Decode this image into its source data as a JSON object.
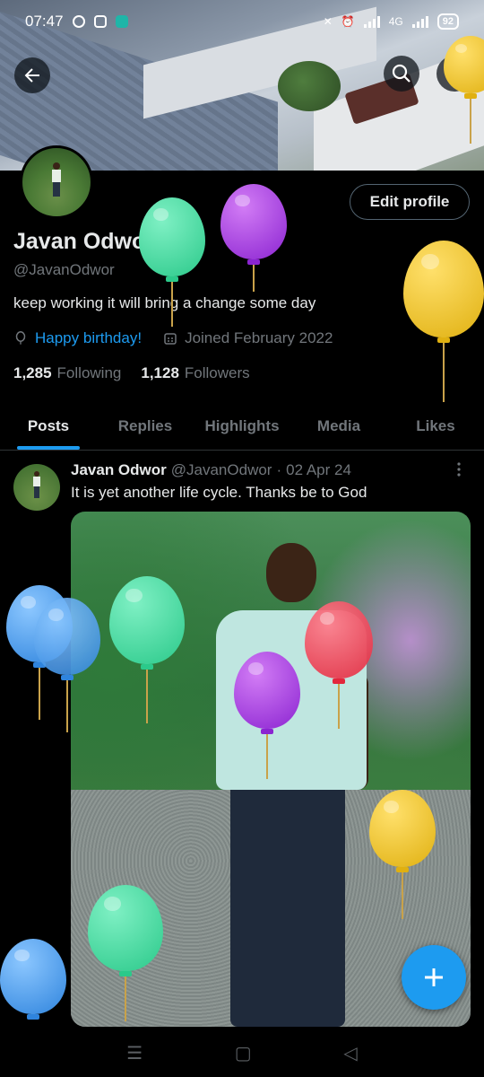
{
  "status": {
    "time": "07:47",
    "battery": "92",
    "network": "4G"
  },
  "profile": {
    "name": "Javan Odwor",
    "handle": "@JavanOdwor",
    "bio": "keep working it will bring a change some day",
    "birthday": "Happy birthday!",
    "joined": "Joined February 2022",
    "following_count": "1,285",
    "following_label": "Following",
    "followers_count": "1,128",
    "followers_label": "Followers",
    "edit_label": "Edit profile"
  },
  "tabs": [
    {
      "label": "Posts",
      "active": true
    },
    {
      "label": "Replies"
    },
    {
      "label": "Highlights"
    },
    {
      "label": "Media"
    },
    {
      "label": "Likes"
    }
  ],
  "post": {
    "name": "Javan Odwor",
    "handle": "@JavanOdwor",
    "dot": "·",
    "date": "02 Apr 24",
    "text": "It is yet another life cycle. Thanks be to God"
  },
  "icons": {
    "back": "arrow-left-icon",
    "search": "search-icon",
    "more": "more-vertical-icon",
    "fab": "plus-icon",
    "location": "balloon-icon",
    "calendar": "calendar-icon"
  },
  "colors": {
    "accent": "#1d9bf0",
    "background": "#000000",
    "muted": "#71767b",
    "balloon_green": "#3fd89f",
    "balloon_purple": "#a23ee0",
    "balloon_yellow": "#f0c419",
    "balloon_blue": "#3a97e8",
    "balloon_red": "#ee3b4e"
  }
}
